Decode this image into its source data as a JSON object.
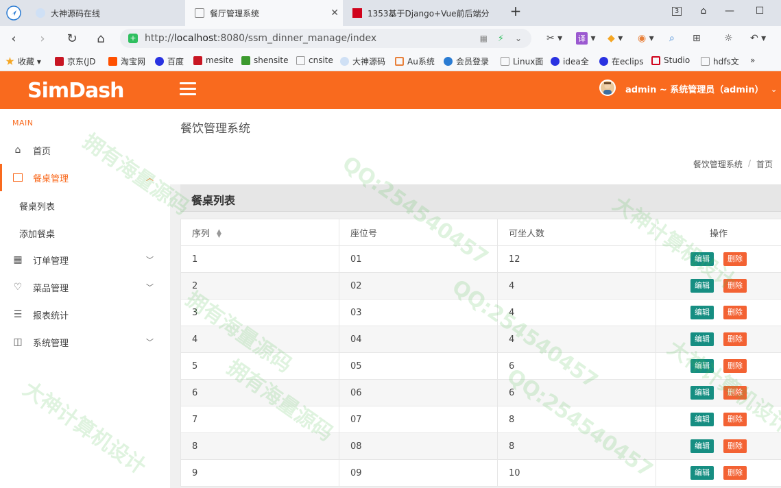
{
  "browser": {
    "tabs": [
      {
        "title": "大神源码在线",
        "icon_color": "#2b7cd3"
      },
      {
        "title": "餐厅管理系统",
        "icon_color": "#888888"
      },
      {
        "title": "1353基于Django+Vue前后端分",
        "icon_color": "#d0021b"
      }
    ],
    "new_tab_label": "+",
    "tab_count": "3",
    "url_prefix": "http://",
    "url_host": "localhost",
    "url_rest": ":8080/ssm_dinner_manage/index",
    "bookmarks": [
      {
        "label": "收藏",
        "color": "#f5a623"
      },
      {
        "label": "京东(JD",
        "color": "#c81623"
      },
      {
        "label": "淘宝网",
        "color": "#ff5000"
      },
      {
        "label": "百度",
        "color": "#2932e1"
      },
      {
        "label": "mesite",
        "color": "#c81623"
      },
      {
        "label": "shensite",
        "color": "#3c9a2e"
      },
      {
        "label": "cnsite",
        "color": "#999999"
      },
      {
        "label": "大神源码",
        "color": "#2b7cd3"
      },
      {
        "label": "Au系统",
        "color": "#e8803a"
      },
      {
        "label": "会员登录",
        "color": "#2b7cd3"
      },
      {
        "label": "Linux面",
        "color": "#999999"
      },
      {
        "label": "idea全",
        "color": "#2932e1"
      },
      {
        "label": "在eclips",
        "color": "#2932e1"
      },
      {
        "label": "Studio",
        "color": "#d0021b"
      },
      {
        "label": "hdfs文",
        "color": "#999999"
      },
      {
        "label": "»",
        "color": ""
      }
    ]
  },
  "header": {
    "logo": "SimDash",
    "user_label": "admin ~ 系统管理员（admin）",
    "brand_color": "#f96a1e"
  },
  "sidebar": {
    "section_label": "MAIN",
    "items": [
      {
        "label": "首页",
        "icon": "home-icon"
      },
      {
        "label": "餐桌管理",
        "icon": "table-mgmt-icon",
        "active": true,
        "expanded": true
      },
      {
        "label": "订单管理",
        "icon": "grid-icon"
      },
      {
        "label": "菜品管理",
        "icon": "heart-icon"
      },
      {
        "label": "报表统计",
        "icon": "list-icon"
      },
      {
        "label": "系统管理",
        "icon": "layout-icon"
      }
    ],
    "sub_items": [
      "餐桌列表",
      "添加餐桌"
    ]
  },
  "main": {
    "page_title": "餐饮管理系统",
    "breadcrumb": [
      "餐饮管理系统",
      "首页"
    ],
    "panel_title": "餐桌列表",
    "columns": [
      "序列",
      "座位号",
      "可坐人数",
      "操作"
    ],
    "edit_label": "编辑",
    "delete_label": "删除",
    "rows": [
      {
        "seq": "1",
        "seat": "01",
        "capacity": "12"
      },
      {
        "seq": "2",
        "seat": "02",
        "capacity": "4"
      },
      {
        "seq": "3",
        "seat": "03",
        "capacity": "4"
      },
      {
        "seq": "4",
        "seat": "04",
        "capacity": "4"
      },
      {
        "seq": "5",
        "seat": "05",
        "capacity": "6"
      },
      {
        "seq": "6",
        "seat": "06",
        "capacity": "6"
      },
      {
        "seq": "7",
        "seat": "07",
        "capacity": "8"
      },
      {
        "seq": "8",
        "seat": "08",
        "capacity": "8"
      },
      {
        "seq": "9",
        "seat": "09",
        "capacity": "10"
      }
    ]
  },
  "watermarks": [
    "拥有海量源码",
    "QQ:254540457",
    "大神计算机设计"
  ]
}
